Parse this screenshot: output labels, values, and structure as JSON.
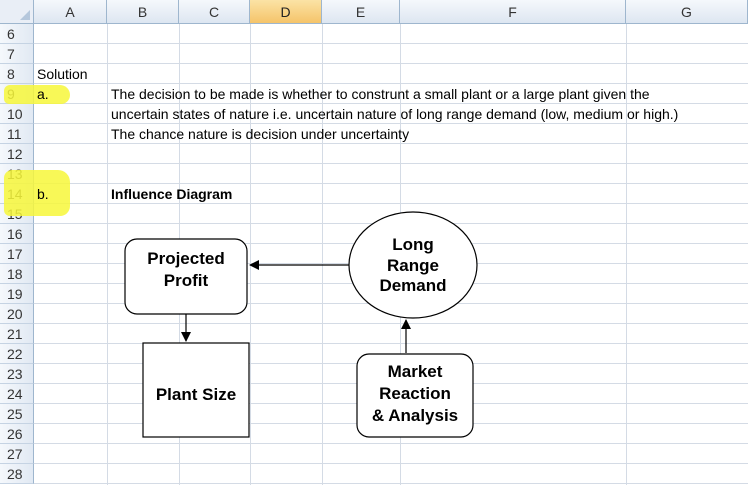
{
  "columns": [
    "A",
    "B",
    "C",
    "D",
    "E",
    "F",
    "G"
  ],
  "selected_column": "D",
  "rows": [
    "6",
    "7",
    "8",
    "9",
    "10",
    "11",
    "12",
    "13",
    "14",
    "15",
    "16",
    "17",
    "18",
    "19",
    "20",
    "21",
    "22",
    "23",
    "24",
    "25",
    "26",
    "27",
    "28"
  ],
  "cells": {
    "a8": "Solution",
    "a9": "a.",
    "b9": "The decision to be made is whether to construnt a small plant or a large plant given the",
    "b10": "uncertain states of nature i.e. uncertain nature of long range demand (low, medium or high.)",
    "b11": "The chance nature is decision under uncertainty",
    "a14": "b.",
    "b14": "Influence Diagram"
  },
  "diagram": {
    "projected_profit": [
      "Projected",
      "Profit"
    ],
    "plant_size": [
      "Plant Size"
    ],
    "long_range_demand": [
      "Long",
      "Range",
      "Demand"
    ],
    "market_reaction": [
      "Market",
      "Reaction",
      "& Analysis"
    ]
  },
  "colors": {
    "highlight": "#f7f73a",
    "header_selected": "#f5c46a",
    "grid": "#d4dbe5"
  }
}
